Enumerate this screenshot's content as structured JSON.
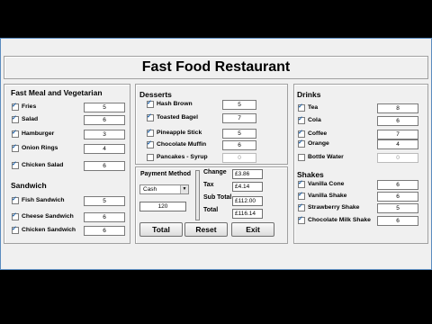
{
  "app": {
    "title": "Fast Food Restaurant"
  },
  "fast_meal": {
    "heading": "Fast Meal and Vegetarian",
    "items": [
      {
        "label": "Fries",
        "qty": "5",
        "checked": true
      },
      {
        "label": "Salad",
        "qty": "6",
        "checked": true
      },
      {
        "label": "Hamburger",
        "qty": "3",
        "checked": true
      },
      {
        "label": "Onion Rings",
        "qty": "4",
        "checked": true
      },
      {
        "label": "Chicken Salad",
        "qty": "6",
        "checked": true
      }
    ]
  },
  "sandwich": {
    "heading": "Sandwich",
    "items": [
      {
        "label": "Fish Sandwich",
        "qty": "5",
        "checked": true
      },
      {
        "label": "Cheese Sandwich",
        "qty": "6",
        "checked": true
      },
      {
        "label": "Chicken Sandwich",
        "qty": "6",
        "checked": true
      }
    ]
  },
  "desserts": {
    "heading": "Desserts",
    "items": [
      {
        "label": "Hash Brown",
        "qty": "5",
        "checked": true
      },
      {
        "label": "Toasted Bagel",
        "qty": "7",
        "checked": true
      },
      {
        "label": "Pineapple Stick",
        "qty": "5",
        "checked": true
      },
      {
        "label": "Chocolate Muffin",
        "qty": "6",
        "checked": true
      },
      {
        "label": "Pancakes - Syrup",
        "qty": "0",
        "checked": false
      }
    ]
  },
  "payment": {
    "label": "Payment Method",
    "method": "Cash",
    "amount": "120",
    "change_label": "Change",
    "change": "£3.86",
    "tax_label": "Tax",
    "tax": "£4.14",
    "subtotal_label": "Sub Total",
    "subtotal": "£112.00",
    "total_label": "Total",
    "total": "£116.14"
  },
  "buttons": {
    "total": "Total",
    "reset": "Reset",
    "exit": "Exit"
  },
  "drinks": {
    "heading": "Drinks",
    "items": [
      {
        "label": "Tea",
        "qty": "8",
        "checked": true
      },
      {
        "label": "Cola",
        "qty": "6",
        "checked": true
      },
      {
        "label": "Coffee",
        "qty": "7",
        "checked": true
      },
      {
        "label": "Orange",
        "qty": "4",
        "checked": true
      },
      {
        "label": "Bottle Water",
        "qty": "0",
        "checked": false
      }
    ]
  },
  "shakes": {
    "heading": "Shakes",
    "items": [
      {
        "label": "Vanilla Cone",
        "qty": "6",
        "checked": true
      },
      {
        "label": "Vanilla Shake",
        "qty": "6",
        "checked": true
      },
      {
        "label": "Strawberry Shake",
        "qty": "5",
        "checked": true
      },
      {
        "label": "Chocolate Milk Shake",
        "qty": "6",
        "checked": true
      }
    ]
  }
}
